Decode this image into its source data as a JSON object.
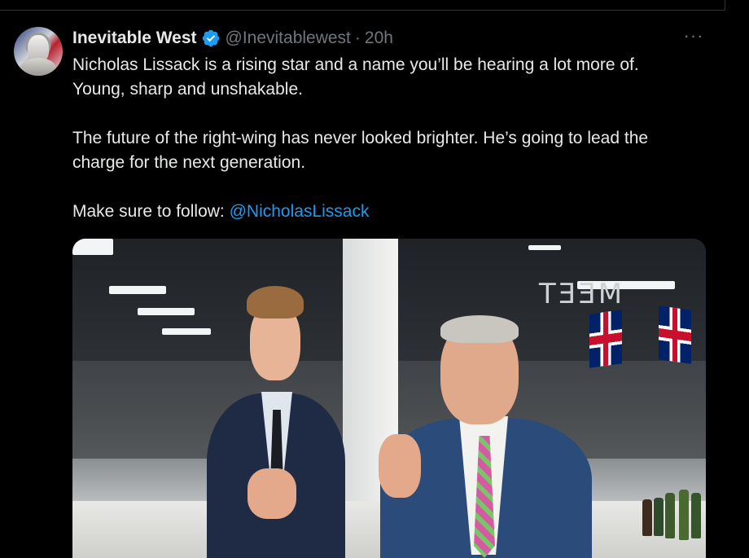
{
  "tweet": {
    "author_name": "Inevitable West",
    "handle": "@Inevitablewest",
    "separator": "·",
    "time": "20h",
    "more_label": "···",
    "verified_icon": "verified-badge-icon",
    "lines": {
      "l1": "Nicholas Lissack is a rising star and a name you’ll be hearing a lot more of.",
      "l2": "Young, sharp and unshakable.",
      "l3": "The future of the right-wing has never looked brighter. He’s going to lead the",
      "l4": "charge for the next generation.",
      "l5_prefix": "Make sure to follow: ",
      "l5_mention": "@NicholasLissack"
    },
    "photo_sign_text": "MEET"
  },
  "colors": {
    "background": "#000000",
    "text": "#e7e9ea",
    "muted": "#71767b",
    "link": "#1d9bf0",
    "verified": "#1d9bf0"
  }
}
